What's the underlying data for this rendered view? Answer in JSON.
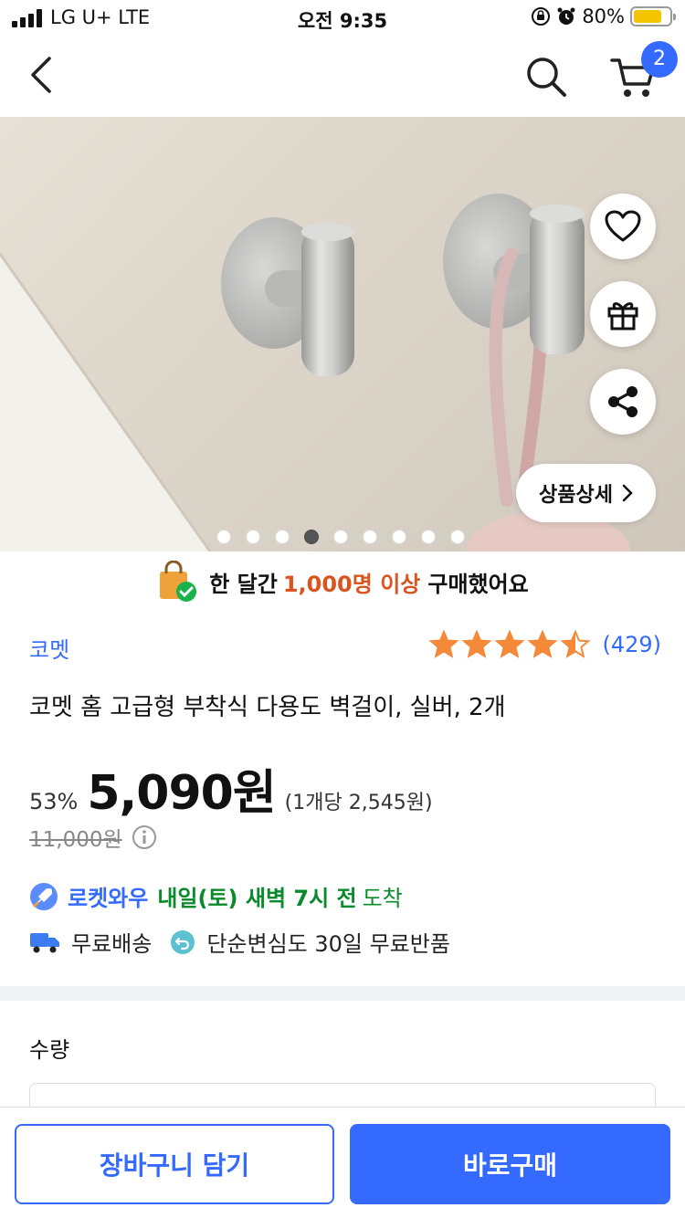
{
  "status_bar": {
    "carrier": "LG U+  LTE",
    "time": "오전 9:35",
    "battery": "80%"
  },
  "nav": {
    "cart_count": "2"
  },
  "hero": {
    "detail_label": "상품상세",
    "dot_count": 9,
    "active_dot": 3
  },
  "banner": {
    "prefix": "한 달간",
    "highlight": "1,000명 이상",
    "suffix": "구매했어요"
  },
  "product": {
    "brand": "코멧",
    "rating": 4.5,
    "review_count": "(429)",
    "title": "코멧 홈 고급형 부착식 다용도 벽걸이, 실버, 2개",
    "discount": "53%",
    "price": "5,090원",
    "unit_price": "(1개당 2,545원)",
    "original_price": "11,000원"
  },
  "delivery": {
    "badge": "로켓와우",
    "arrival_time": "내일(토) 새벽 7시 전",
    "arrival_suffix": "도착",
    "free_shipping": "무료배송",
    "return_policy": "단순변심도 30일 무료반품"
  },
  "quantity": {
    "label": "수량"
  },
  "actions": {
    "add_to_cart": "장바구니 담기",
    "buy_now": "바로구매"
  },
  "colors": {
    "accent": "#346aff",
    "highlight": "#d9541e",
    "arrival": "#0a8a2a",
    "star": "#f5893a"
  }
}
